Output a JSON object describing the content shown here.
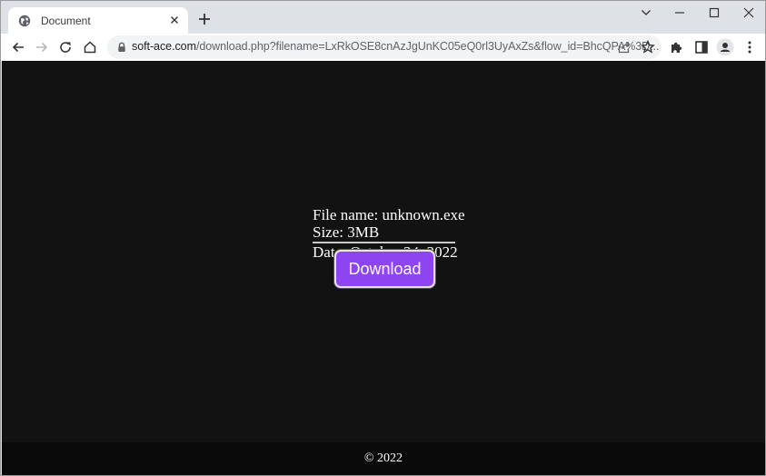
{
  "browser": {
    "tab": {
      "title": "Document",
      "favicon": "globe-icon",
      "close_icon": "close-icon"
    },
    "new_tab_icon": "plus-icon",
    "window_controls": [
      "tab-search-chevron-icon",
      "minimize-icon",
      "maximize-icon",
      "close-icon"
    ],
    "nav": [
      "back-icon",
      "forward-icon",
      "reload-icon",
      "home-icon"
    ],
    "address_bar": {
      "security_icon": "lock-icon",
      "host": "soft-ace.com",
      "path": "/download.php?filename=LxRkOSE8cnAzJgUnKC05eQ0rl3UyAxZs&flow_id=BhcQPA%3D..."
    },
    "toolbar_icons": [
      "share-icon",
      "bookmark-star-icon",
      "extensions-puzzle-icon",
      "side-panel-icon",
      "profile-avatar-icon",
      "menu-kebab-icon"
    ]
  },
  "page": {
    "file_name_line": "File name: unknown.exe",
    "size_line": "Size: 3MB",
    "date_line": "Date: October 24, 2022",
    "download_label": "Download",
    "footer_text": "© 2022",
    "button_color": "#8e44f0",
    "background_color": "#121212"
  }
}
